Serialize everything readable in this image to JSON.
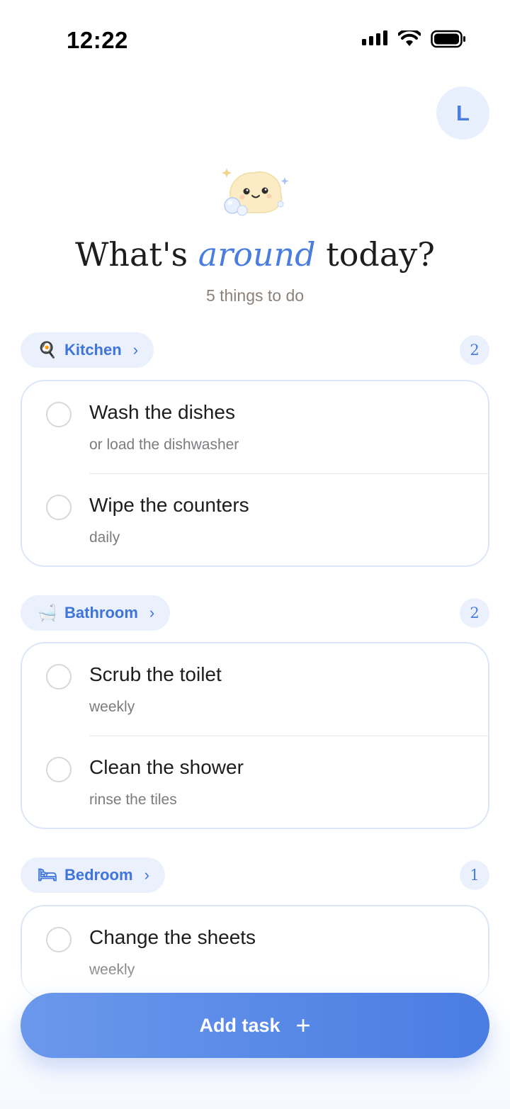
{
  "status_bar": {
    "time": "12:22"
  },
  "profile": {
    "initial": "L"
  },
  "header": {
    "title_before": "What's ",
    "title_accent": "around",
    "title_after": " today?",
    "subtitle": "5 things to do"
  },
  "categories": [
    {
      "label": "Kitchen",
      "icon": "frying-pan-icon",
      "emoji": "🍳",
      "count": "2",
      "tasks": [
        {
          "title": "Wash the dishes",
          "note": "or load the dishwasher"
        },
        {
          "title": "Wipe the counters",
          "note": "daily"
        }
      ]
    },
    {
      "label": "Bathroom",
      "icon": "bathtub-icon",
      "emoji": "🛁",
      "count": "2",
      "tasks": [
        {
          "title": "Scrub the toilet",
          "note": "weekly"
        },
        {
          "title": "Clean the shower",
          "note": "rinse the tiles"
        }
      ]
    },
    {
      "label": "Bedroom",
      "icon": "bed-icon",
      "emoji": "🛏",
      "count": "1",
      "tasks": [
        {
          "title": "Change the sheets",
          "note": "weekly"
        }
      ]
    }
  ],
  "actions": {
    "add_task_label": "Add task"
  },
  "colors": {
    "accent": "#4a7de0",
    "pill_bg": "#eaf1fd",
    "card_border": "#dce6f6"
  }
}
